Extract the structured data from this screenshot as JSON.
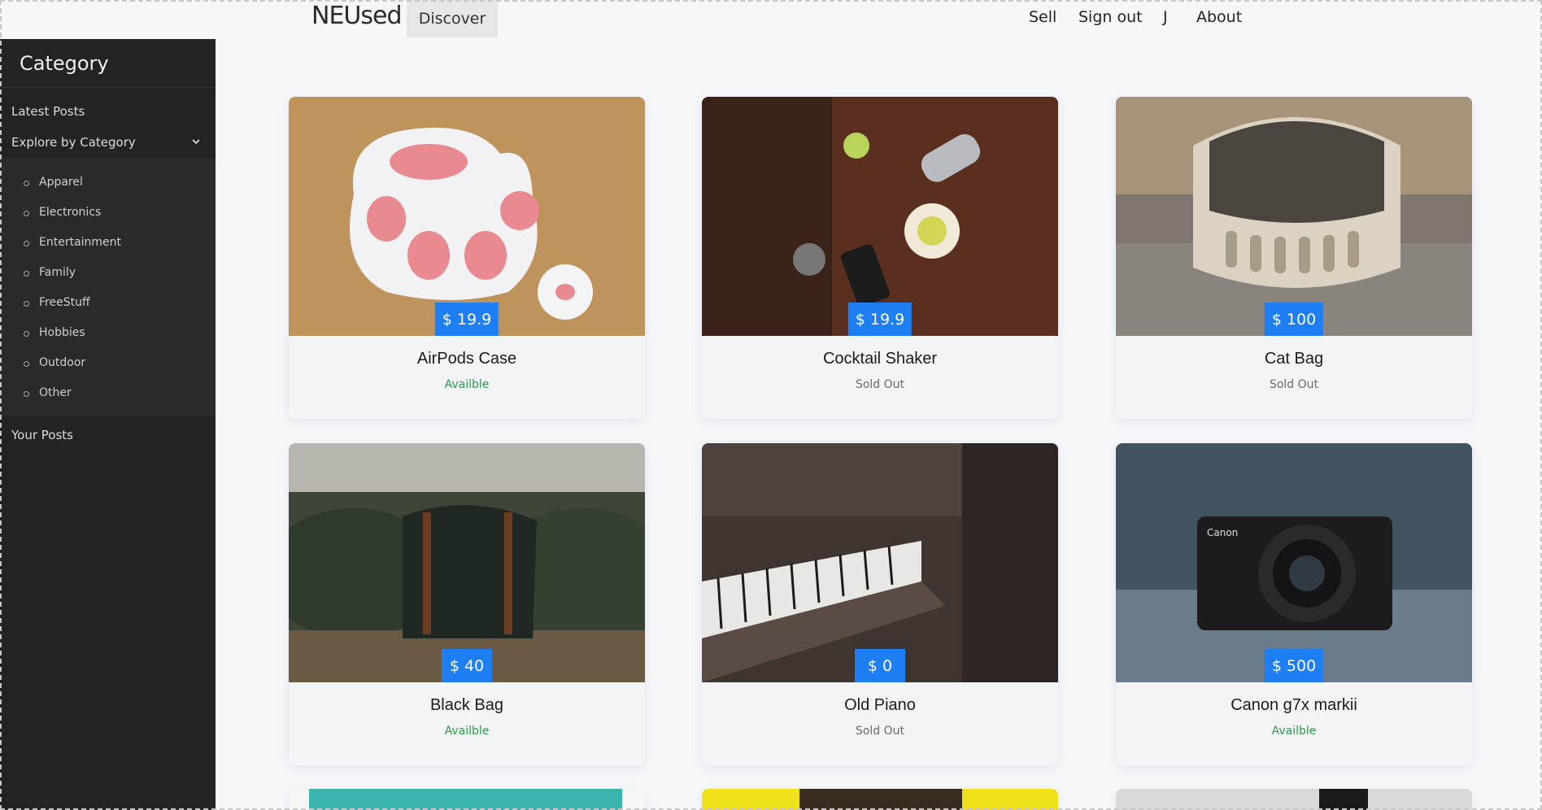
{
  "nav": {
    "brand": "NEUsed",
    "discover": "Discover",
    "sell": "Sell",
    "sign_out": "Sign out",
    "user": "J",
    "about": "About"
  },
  "sidebar": {
    "title": "Category",
    "latest": "Latest Posts",
    "explore": "Explore by Category",
    "categories": [
      "Apparel",
      "Electronics",
      "Entertainment",
      "Family",
      "FreeStuff",
      "Hobbies",
      "Outdoor",
      "Other"
    ],
    "your_posts": "Your Posts"
  },
  "products": [
    {
      "title": "AirPods Case",
      "price": "19.9",
      "currency": "$",
      "status": "Availble"
    },
    {
      "title": "Cocktail Shaker",
      "price": "19.9",
      "currency": "$",
      "status": "Sold Out"
    },
    {
      "title": "Cat Bag",
      "price": "100",
      "currency": "$",
      "status": "Sold Out"
    },
    {
      "title": "Black Bag",
      "price": "40",
      "currency": "$",
      "status": "Availble"
    },
    {
      "title": "Old Piano",
      "price": "0",
      "currency": "$",
      "status": "Sold Out"
    },
    {
      "title": "Canon g7x markii",
      "price": "500",
      "currency": "$",
      "status": "Availble"
    }
  ],
  "colors": {
    "accent": "#1e7ef4",
    "available": "#2f9a4e",
    "sidebar": "#232323"
  }
}
